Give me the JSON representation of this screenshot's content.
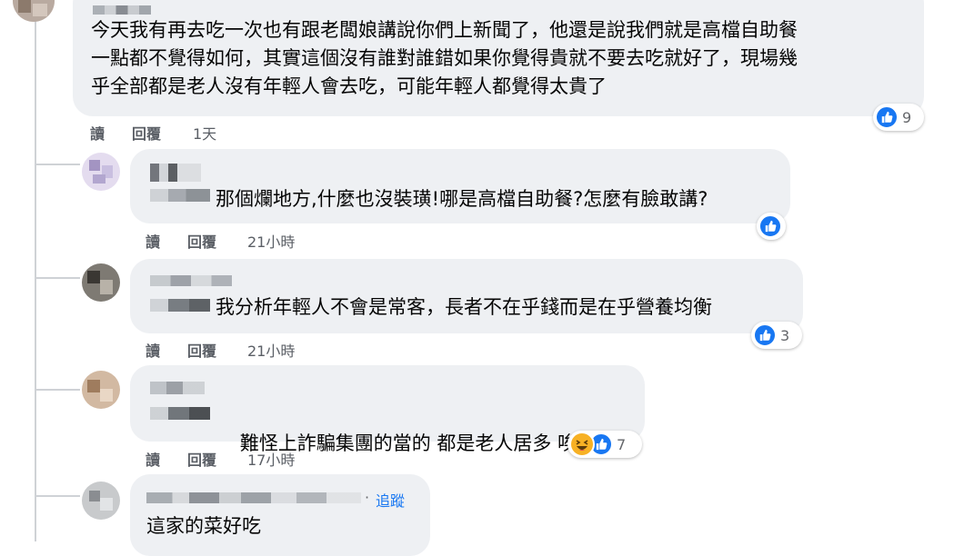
{
  "comments": [
    {
      "text": "今天我有再去吃一次也有跟老闆娘講說你們上新聞了，他還是說我們就是高檔自助餐\n一點都不覺得如何，其實這個沒有誰對誰錯如果你覺得貴就不要去吃就好了，現場幾\n乎全部都是老人沒有年輕人會去吃，可能年輕人都覺得太貴了",
      "read_label": "讀",
      "reply_label": "回覆",
      "time": "1天",
      "reaction_count": "9"
    },
    {
      "text": "那個爛地方,什麼也沒裝璜!哪是高檔自助餐?怎麼有臉敢講?",
      "read_label": "讀",
      "reply_label": "回覆",
      "time": "21小時"
    },
    {
      "text": "我分析年輕人不會是常客，長者不在乎錢而是在乎營養均衡",
      "read_label": "讀",
      "reply_label": "回覆",
      "time": "21小時",
      "reaction_count": "3"
    },
    {
      "text": "難怪上詐騙集團的當的 都是老人居多 唉",
      "emoji": "😌",
      "read_label": "讀",
      "reply_label": "回覆",
      "time": "17小時",
      "reaction_count": "7"
    },
    {
      "text": "這家的菜好吃",
      "separator": "·",
      "follow_label": "追蹤"
    }
  ],
  "colors": {
    "bubble": "#eef0f3",
    "like": "#1877f2",
    "haha": "#f7b125",
    "meta_text": "#5b5f66"
  },
  "icons": {
    "like": "like-icon",
    "haha": "haha-icon"
  }
}
